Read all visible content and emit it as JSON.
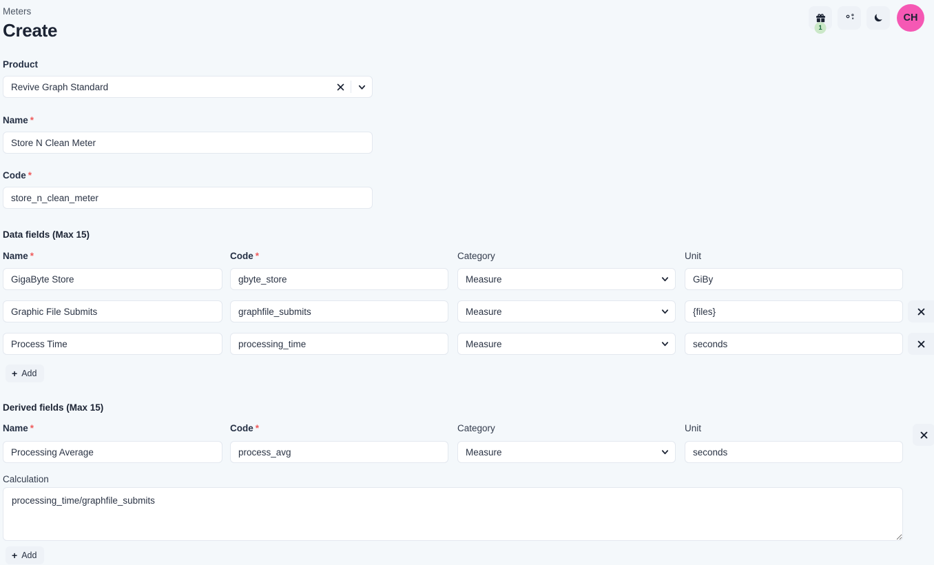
{
  "header": {
    "breadcrumb": "Meters",
    "title": "Create",
    "gift_badge": "1",
    "avatar_initials": "CH",
    "avatar_color": "#f558b4",
    "icons": [
      "gift-icon",
      "cogs-icon",
      "moon-icon"
    ]
  },
  "product": {
    "label": "Product",
    "value": "Revive Graph Standard",
    "options": [
      "Revive Graph Standard"
    ]
  },
  "name": {
    "label": "Name",
    "required": "*",
    "value": "Store N Clean Meter"
  },
  "code": {
    "label": "Code",
    "required": "*",
    "value": "store_n_clean_meter"
  },
  "data_fields": {
    "section_title": "Data fields (Max 15)",
    "columns": {
      "name": "Name",
      "code": "Code",
      "category": "Category",
      "unit": "Unit"
    },
    "required_marks": {
      "name": "*",
      "code": "*"
    },
    "rows": [
      {
        "name": "GigaByte Store",
        "code": "gbyte_store",
        "category": "Measure",
        "unit": "GiBy",
        "deletable": false
      },
      {
        "name": "Graphic File Submits",
        "code": "graphfile_submits",
        "category": "Measure",
        "unit": "{files}",
        "deletable": true
      },
      {
        "name": "Process Time",
        "code": "processing_time",
        "category": "Measure",
        "unit": "seconds",
        "deletable": true
      }
    ],
    "category_options": [
      "Measure"
    ],
    "add_label": "Add"
  },
  "derived_fields": {
    "section_title": "Derived fields (Max 15)",
    "columns": {
      "name": "Name",
      "code": "Code",
      "category": "Category",
      "unit": "Unit"
    },
    "required_marks": {
      "name": "*",
      "code": "*"
    },
    "rows": [
      {
        "name": "Processing Average",
        "code": "process_avg",
        "category": "Measure",
        "unit": "seconds",
        "deletable": true
      }
    ],
    "category_options": [
      "Measure"
    ],
    "calculation_label": "Calculation",
    "calculation_value": "processing_time/graphfile_submits",
    "add_label": "Add"
  }
}
